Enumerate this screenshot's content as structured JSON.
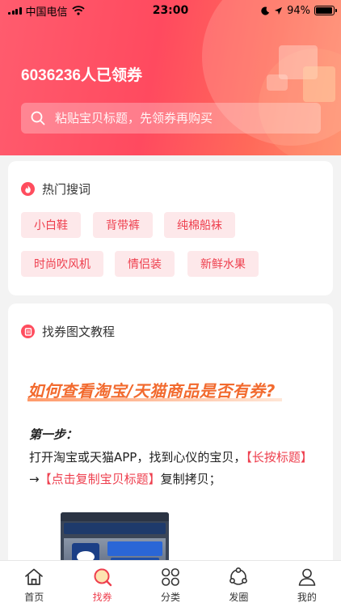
{
  "status_bar": {
    "carrier": "中国电信",
    "time": "23:00",
    "battery_text": "94%",
    "battery_level": 0.94
  },
  "hero": {
    "count_text": "6036236人已领券",
    "search": {
      "placeholder": "粘贴宝贝标题，先领券再购买"
    }
  },
  "hot_search": {
    "title": "热门搜词",
    "tags": [
      "小白鞋",
      "背带裤",
      "纯棉船袜",
      "时尚吹风机",
      "情侣装",
      "新鲜水果"
    ]
  },
  "tutorial": {
    "title": "找券图文教程",
    "heading": "如何查看淘宝/天猫商品是否有券?",
    "step_label": "第一步：",
    "text_1": "打开淘宝或天猫APP，找到心仪的宝贝，",
    "highlight_1": "【长按标题】",
    "text_2": "→",
    "highlight_2": "【点击复制宝贝标题】",
    "text_3": "复制拷贝；"
  },
  "tab_bar": {
    "tabs": [
      {
        "label": "首页",
        "icon": "home-icon",
        "active": false
      },
      {
        "label": "找券",
        "icon": "coupon-search-icon",
        "active": true
      },
      {
        "label": "分类",
        "icon": "category-icon",
        "active": false
      },
      {
        "label": "发圈",
        "icon": "share-icon",
        "active": false
      },
      {
        "label": "我的",
        "icon": "user-icon",
        "active": false
      }
    ]
  },
  "colors": {
    "accent": "#ee3f4e",
    "tag_bg": "#fde8ea",
    "hero_start": "#ff5c6e",
    "hero_end": "#ff8a6b"
  }
}
